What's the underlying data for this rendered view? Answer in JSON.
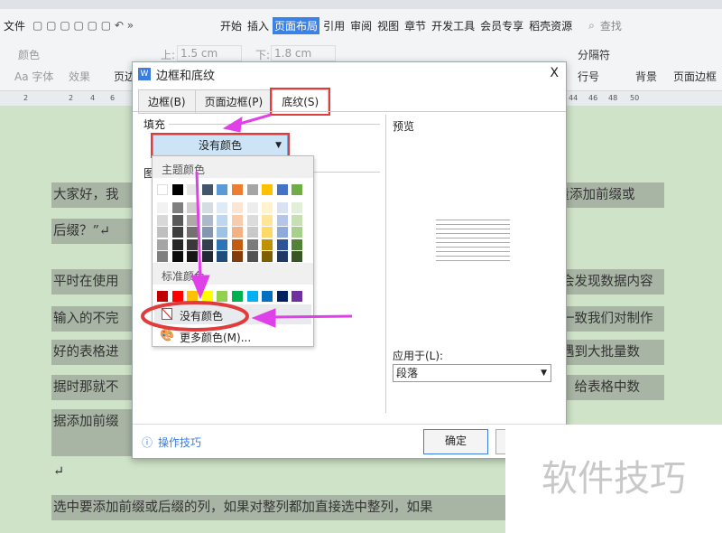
{
  "menubar": {
    "file": "文件",
    "tabs": [
      "开始",
      "插入",
      "页面布局",
      "引用",
      "审阅",
      "视图",
      "章节",
      "开发工具",
      "会员专享",
      "稻壳资源"
    ],
    "search": "查找"
  },
  "ribbon": {
    "color": "颜色",
    "font": "Aa 字体",
    "effect": "效果",
    "margin": "页边",
    "top_label": "上:",
    "top_value": "1.5 cm",
    "bottom_label": "下:",
    "bottom_value": "1.8 cm",
    "separator": "分隔符",
    "line_number": "行号",
    "background": "背景",
    "page_border": "页面边框"
  },
  "ruler": [
    "2",
    "2",
    "4",
    "6",
    "44",
    "46",
    "48",
    "50"
  ],
  "document": {
    "lines": [
      "大家好，我",
      "批量添加前缀或",
      "后缀？”↵",
      "平时在使用",
      "会发现数据内容",
      "输入的不完",
      "一致我们对制作",
      "好的表格进",
      "遇到大批量数",
      "据时那就不",
      "，给表格中数",
      "据添加前缀",
      "↵",
      "选中要添加前缀或后缀的列，如果对整列都加直接选中整列，如果"
    ]
  },
  "dialog": {
    "title": "边框和底纹",
    "close": "X",
    "tabs": [
      "边框(B)",
      "页面边框(P)",
      "底纹(S)"
    ],
    "fill_label": "填充",
    "fill_value": "没有颜色",
    "pattern_label": "图",
    "preview_label": "预览",
    "apply_label": "应用于(L):",
    "apply_value": "段落",
    "tips": "操作技巧",
    "ok": "确定"
  },
  "color_menu": {
    "theme_label": "主题颜色",
    "standard_label": "标准颜色",
    "no_color": "没有颜色",
    "more_colors": "更多颜色(M)...",
    "theme": [
      "#ffffff",
      "#000000",
      "#e7e6e6",
      "#44546a",
      "#5b9bd5",
      "#ed7d31",
      "#a5a5a5",
      "#ffc000",
      "#4472c4",
      "#70ad47"
    ],
    "shades": [
      [
        "#f2f2f2",
        "#7f7f7f",
        "#d0cece",
        "#d6dce4",
        "#deebf6",
        "#fbe5d5",
        "#ededed",
        "#fff2cc",
        "#d9e2f3",
        "#e2efd9"
      ],
      [
        "#d8d8d8",
        "#595959",
        "#aeaaaa",
        "#adb9ca",
        "#bdd7ee",
        "#f7cbac",
        "#dbdbdb",
        "#fee599",
        "#b4c6e7",
        "#c5e0b3"
      ],
      [
        "#bfbfbf",
        "#3f3f3f",
        "#757070",
        "#8496b0",
        "#9cc3e5",
        "#f4b183",
        "#c9c9c9",
        "#ffd965",
        "#8eaadb",
        "#a8d08d"
      ],
      [
        "#a5a5a5",
        "#262626",
        "#3a3838",
        "#323f4f",
        "#2e75b5",
        "#c55a11",
        "#7b7b7b",
        "#bf9000",
        "#2f5496",
        "#538135"
      ],
      [
        "#7f7f7f",
        "#0c0c0c",
        "#171616",
        "#222a35",
        "#1e4e79",
        "#833c0b",
        "#525252",
        "#7f6000",
        "#1f3864",
        "#375623"
      ]
    ],
    "standard": [
      "#c00000",
      "#ff0000",
      "#ffc000",
      "#ffff00",
      "#92d050",
      "#00b050",
      "#00b0f0",
      "#0070c0",
      "#002060",
      "#7030a0"
    ]
  },
  "watermark": "软件技巧",
  "colors": {
    "accent": "#3b82e6",
    "highlight": "#e23b3b",
    "arrow": "#e040e8"
  }
}
